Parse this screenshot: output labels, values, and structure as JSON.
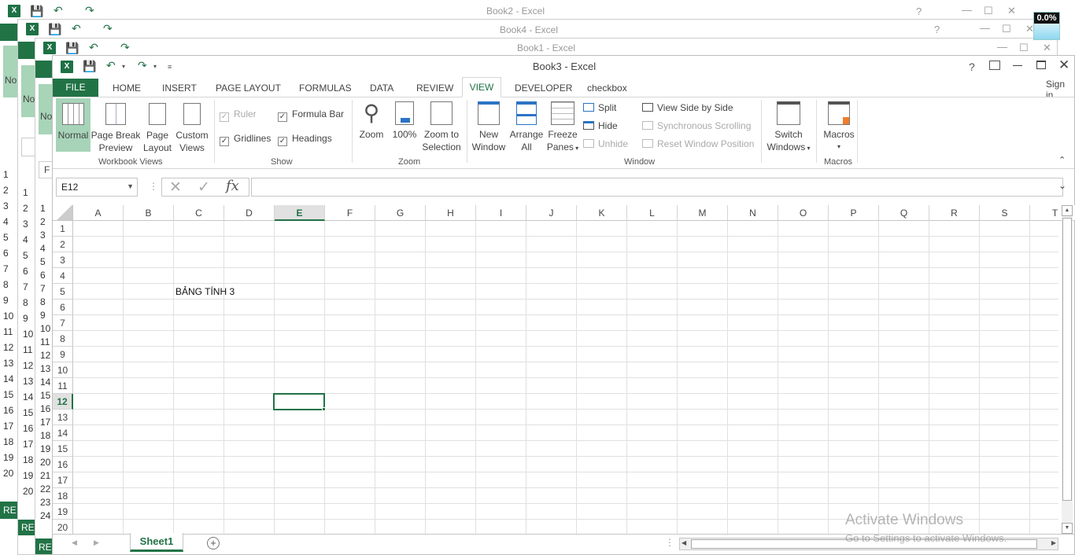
{
  "back_windows": [
    {
      "title": "Book2 - Excel",
      "icon": "X"
    },
    {
      "title": "Book4 - Excel",
      "icon": "X"
    },
    {
      "title": "Book1 - Excel",
      "icon": "X"
    }
  ],
  "back_fragments": {
    "no1": "No",
    "no2": "No",
    "no3": "No",
    "fx_frag": "F",
    "re1": "RE",
    "re2": "RE",
    "re3": "RE"
  },
  "overlay_badge": "0.0%",
  "window": {
    "title": "Book3 - Excel",
    "help": "?",
    "sign_in": "Sign in"
  },
  "tabs": [
    "FILE",
    "HOME",
    "INSERT",
    "PAGE LAYOUT",
    "FORMULAS",
    "DATA",
    "REVIEW",
    "VIEW",
    "DEVELOPER",
    "checkbox"
  ],
  "ribbon": {
    "workbook_views": {
      "label": "Workbook Views",
      "normal": "Normal",
      "page_break_1": "Page Break",
      "page_break_2": "Preview",
      "page_layout_1": "Page",
      "page_layout_2": "Layout",
      "custom_1": "Custom",
      "custom_2": "Views"
    },
    "show": {
      "label": "Show",
      "ruler": "Ruler",
      "formula_bar": "Formula Bar",
      "gridlines": "Gridlines",
      "headings": "Headings"
    },
    "zoom": {
      "label": "Zoom",
      "zoom": "Zoom",
      "hundred": "100%",
      "zoom_sel_1": "Zoom to",
      "zoom_sel_2": "Selection"
    },
    "window_group": {
      "label": "Window",
      "new_1": "New",
      "new_2": "Window",
      "arrange_1": "Arrange",
      "arrange_2": "All",
      "freeze_1": "Freeze",
      "freeze_2": "Panes",
      "split": "Split",
      "hide": "Hide",
      "unhide": "Unhide",
      "side": "View Side by Side",
      "sync": "Synchronous Scrolling",
      "reset": "Reset Window Position",
      "switch_1": "Switch",
      "switch_2": "Windows"
    },
    "macros": {
      "label": "Macros",
      "macros": "Macros"
    }
  },
  "formula_bar": {
    "name_box": "E12",
    "formula": ""
  },
  "grid": {
    "columns": [
      "A",
      "B",
      "C",
      "D",
      "E",
      "F",
      "G",
      "H",
      "I",
      "J",
      "K",
      "L",
      "M",
      "N",
      "O",
      "P",
      "Q",
      "R",
      "S",
      "T"
    ],
    "rows": [
      "1",
      "2",
      "3",
      "4",
      "5",
      "6",
      "7",
      "8",
      "9",
      "10",
      "11",
      "12",
      "13",
      "14",
      "15",
      "16",
      "17",
      "18",
      "19",
      "20"
    ],
    "active_cell": "E12",
    "cell_c5": "BẢNG TÍNH 3"
  },
  "sheet_tabs": [
    "Sheet1"
  ],
  "watermark": {
    "line1": "Activate Windows",
    "line2": "Go to Settings to activate Windows."
  }
}
